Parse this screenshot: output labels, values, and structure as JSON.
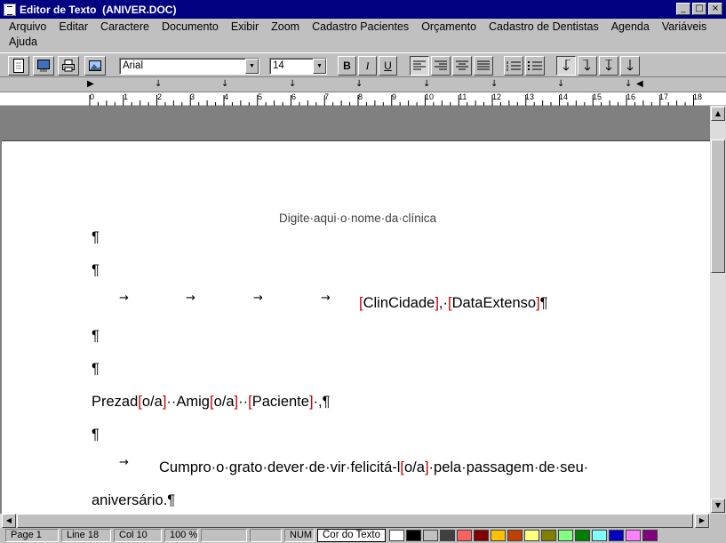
{
  "window": {
    "title": "Editor de Texto  (ANIVER.DOC)",
    "buttons": [
      "_",
      "□",
      "×"
    ]
  },
  "menu": [
    "Arquivo",
    "Editar",
    "Caractere",
    "Documento",
    "Exibir",
    "Zoom",
    "Cadastro Pacientes",
    "Orçamento",
    "Cadastro de Dentistas",
    "Agenda",
    "Variáveis",
    "Ajuda"
  ],
  "toolbar": {
    "font": "Arial",
    "size": "14",
    "bold": "B",
    "italic": "I",
    "underline": "U"
  },
  "ruler": {
    "numbers": [
      "0",
      "1",
      "2",
      "3",
      "4",
      "5",
      "6",
      "7",
      "8",
      "9",
      "10",
      "11",
      "12",
      "13",
      "14",
      "15",
      "16",
      "17",
      "18"
    ]
  },
  "document": {
    "header": "Digite·aqui·o·nome·da·clínica",
    "pilcrow": "¶",
    "tab_glyph": "→",
    "date_line": {
      "b1": "[",
      "f1": "ClinCidade",
      "b2": "]",
      "mid": ",·",
      "b3": "[",
      "f2": "DataExtenso",
      "b4": "]",
      "end": "¶"
    },
    "greeting": {
      "t1": "Prezad",
      "m1": "[",
      "v1": "o/a",
      "m2": "]",
      "t2": "··Amig",
      "m3": "[",
      "v2": "o/a",
      "m4": "]",
      "t3": "··",
      "m5": "[",
      "v3": "Paciente",
      "m6": "]",
      "t4": "·,¶"
    },
    "body1": {
      "t1": "Cumpro·o·grato·dever·de·vir·felicitá-l",
      "m1": "[",
      "v1": "o/a",
      "m2": "]",
      "t2": "·pela·passagem·de·seu·"
    },
    "body2": "aniversário.¶"
  },
  "status": {
    "page": "Page   1",
    "line": "Line 18",
    "col": "Col 10",
    "zoom": "100 %",
    "num": "NUM",
    "color_label": "Cor do Texto"
  },
  "colors": {
    "merge_field": "#c00000",
    "palette": [
      "#ffffff",
      "#000000",
      "#c0c0c0",
      "#404040",
      "#ff6060",
      "#800000",
      "#ffc000",
      "#c04000",
      "#ffff80",
      "#808000",
      "#80ff80",
      "#008000",
      "#80ffff",
      "#0000c0",
      "#ff80ff",
      "#800080"
    ]
  }
}
